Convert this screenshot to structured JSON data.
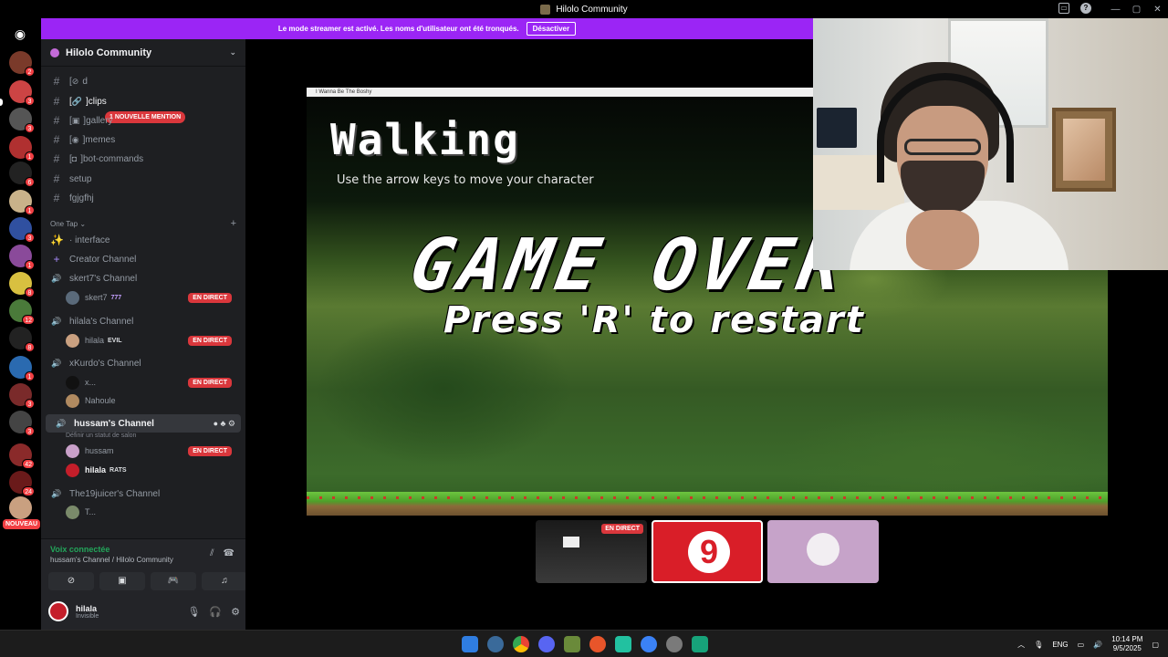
{
  "window": {
    "title": "Hilolo Community"
  },
  "banner": {
    "text": "Le mode streamer est activé. Les noms d'utilisateur ont été tronqués.",
    "button": "Désactiver"
  },
  "rail": {
    "badges": [
      "2",
      "3",
      "3",
      "1",
      "6",
      "1",
      "3",
      "1",
      "8",
      "12",
      "8",
      "1",
      "3",
      "42",
      "24"
    ],
    "nouveau": "NOUVEAU"
  },
  "server": {
    "name": "Hilolo Community"
  },
  "mention_pill": "1 NOUVELLE MENTION",
  "channels": [
    {
      "name": "d",
      "emoji": "⊘",
      "bracket": true
    },
    {
      "name": "clips",
      "emoji": "🔗",
      "bracket": true
    },
    {
      "name": "gallery",
      "emoji": "▣",
      "bracket": true
    },
    {
      "name": "memes",
      "emoji": "◉",
      "bracket": true
    },
    {
      "name": "bot-commands",
      "emoji": "◘",
      "bracket": true
    },
    {
      "name": "setup"
    },
    {
      "name": "fgjgfhj"
    }
  ],
  "category": {
    "name": "One Tap"
  },
  "interface_channel": "· interface",
  "creator_channel": "Creator Channel",
  "voice_channels": [
    {
      "name": "skert7's Channel",
      "users": [
        {
          "name": "skert7",
          "tag": "777",
          "live": "EN DIRECT"
        }
      ]
    },
    {
      "name": "hilala's Channel",
      "users": [
        {
          "name": "hilala",
          "tag": "EVIL",
          "live": "EN DIRECT"
        }
      ]
    },
    {
      "name": "xKurdo's Channel",
      "users": [
        {
          "name": "x...",
          "live": "EN DIRECT"
        },
        {
          "name": "Nahoule"
        }
      ]
    },
    {
      "name": "hussam's Channel",
      "status": "Définir un statut de salon",
      "users": [
        {
          "name": "hussam",
          "live": "EN DIRECT"
        },
        {
          "name": "hilala",
          "tag": "RATS"
        }
      ]
    },
    {
      "name": "The19juicer's Channel",
      "users": [
        {
          "name": "T..."
        }
      ]
    }
  ],
  "voice": {
    "status": "Voix connectée",
    "location": "hussam's Channel / Hilolo Community"
  },
  "user": {
    "name": "hilala",
    "status": "Invisible"
  },
  "game": {
    "window_title": "I Wanna Be The Boshy",
    "heading": "Walking",
    "subtitle": "Use the arrow keys to move your character",
    "game_over": "GAME OVER",
    "press": "Press 'R' to restart"
  },
  "tiles": [
    {
      "label": "EN DIRECT"
    },
    {
      "logo": "9"
    },
    {}
  ],
  "taskbar": {
    "lang": "ENG",
    "time": "10:14 PM",
    "date": "9/5/2025"
  },
  "colors": {
    "accent": "#9b25f5",
    "live": "#da373c",
    "voice_ok": "#23a55a"
  }
}
